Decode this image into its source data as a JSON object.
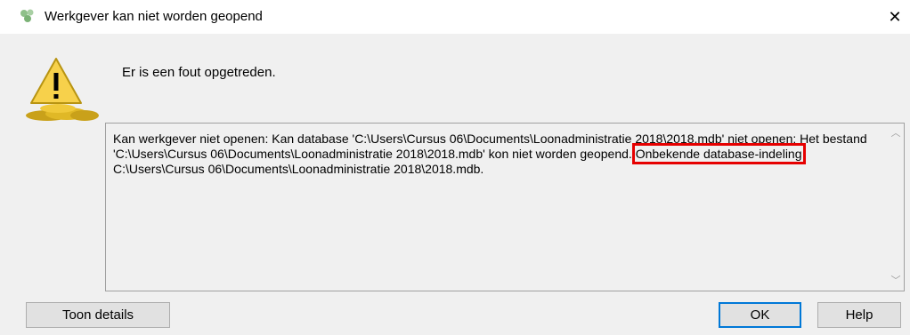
{
  "window": {
    "title": "Werkgever kan niet worden geopend",
    "close_label": "✕"
  },
  "header": {
    "message": "Er is een fout opgetreden."
  },
  "error": {
    "text_part1": "Kan werkgever niet openen: Kan database 'C:\\Users\\Cursus 06\\Documents\\Loonadministratie 2018\\2018.mdb' niet openen: Het bestand 'C:\\Users\\Cursus 06\\Documents\\Loonadministratie 2018\\2018.mdb' kon niet worden geopend.",
    "highlighted": "Onbekende database-indeling",
    "text_part2": " C:\\Users\\Cursus 06\\Documents\\Loonadministratie 2018\\2018.mdb."
  },
  "buttons": {
    "details_label": "Toon details",
    "ok_label": "OK",
    "help_label": "Help"
  },
  "icons": {
    "title": "app-coins-icon",
    "warning": "warning-coins-icon"
  },
  "colors": {
    "highlight_border": "#e60000",
    "default_button_border": "#0078d7"
  }
}
